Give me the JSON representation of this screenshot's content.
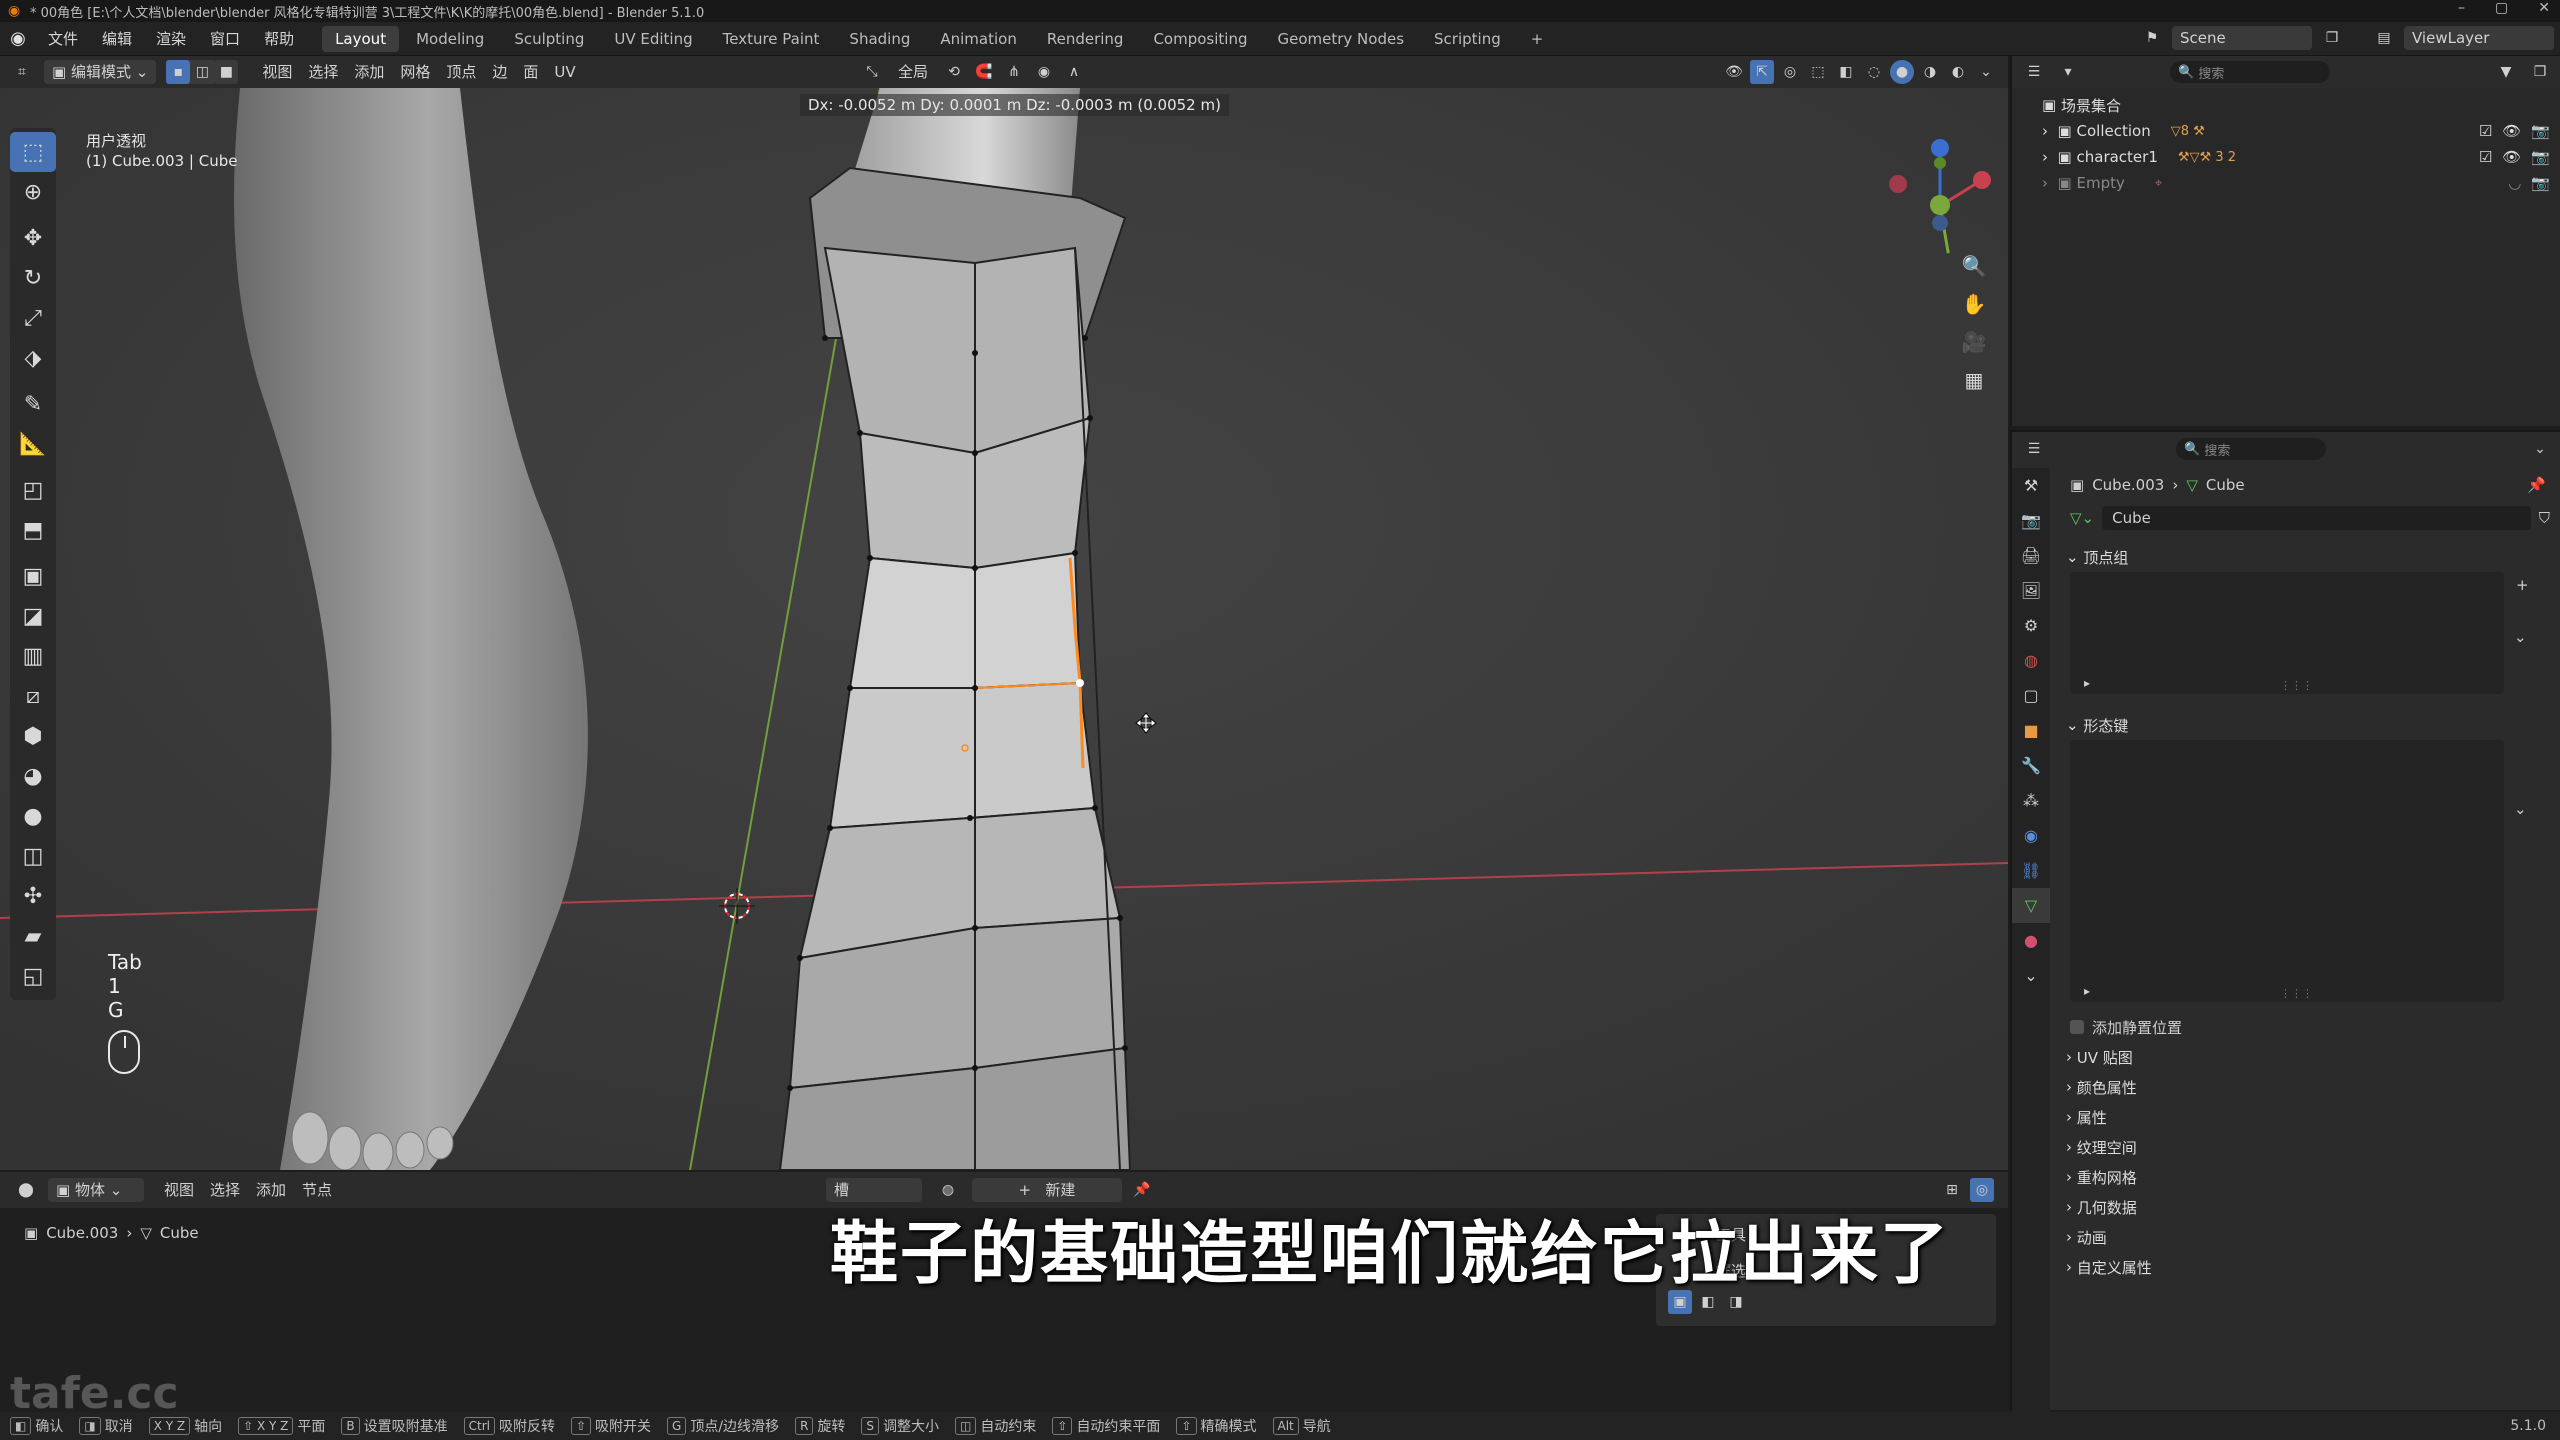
{
  "titlebar": {
    "title": "* 00角色 [E:\\个人文档\\blender\\blender 风格化专辑特训营 3\\工程文件\\K\\K的摩托\\00角色.blend] - Blender 5.1.0",
    "min": "–",
    "max": "▢",
    "close": "✕"
  },
  "menu": {
    "file": "文件",
    "edit": "编辑",
    "render": "渲染",
    "window": "窗口",
    "help": "帮助"
  },
  "workspaces": [
    "Layout",
    "Modeling",
    "Sculpting",
    "UV Editing",
    "Texture Paint",
    "Shading",
    "Animation",
    "Rendering",
    "Compositing",
    "Geometry Nodes",
    "Scripting"
  ],
  "workspace_add": "+",
  "scene": {
    "label": "Scene",
    "viewlayer": "ViewLayer"
  },
  "viewport_header": {
    "mode": "编辑模式",
    "menus": [
      "视图",
      "选择",
      "添加",
      "网格",
      "顶点",
      "边",
      "面",
      "UV"
    ],
    "transform_orientation": "全局"
  },
  "viewport": {
    "view_name": "用户透视",
    "object_info": "(1) Cube.003 | Cube",
    "delta_readout": "Dx: -0.0052 m   Dy:  0.0001 m   Dz: -0.0003 m (0.0052 m)",
    "keys_overlay": [
      "Tab",
      "1",
      "G"
    ]
  },
  "outliner": {
    "search_placeholder": "搜索",
    "root": "场景集合",
    "items": [
      {
        "name": "Collection",
        "badge": "8"
      },
      {
        "name": "character1",
        "badge": "3  2"
      },
      {
        "name": "Empty",
        "badge": ""
      }
    ]
  },
  "properties": {
    "search_placeholder": "搜索",
    "breadcrumb_object": "Cube.003",
    "breadcrumb_data": "Cube",
    "mesh_name": "Cube",
    "panels": {
      "vertex_groups": "顶点组",
      "shape_keys": "形态键",
      "add_rest_position": "添加静置位置",
      "uv_maps": "UV 贴图",
      "color_attributes": "颜色属性",
      "attributes": "属性",
      "texture_space": "纹理空间",
      "remesh": "重构网格",
      "geometry_data": "几何数据",
      "animation": "动画",
      "custom_props": "自定义属性"
    }
  },
  "bottom_editor": {
    "mode": "物体",
    "menus": [
      "视图",
      "选择",
      "添加",
      "节点"
    ],
    "slot": "槽",
    "new_button": "新建",
    "breadcrumb_object": "Cube.003",
    "breadcrumb_data": "Cube",
    "tool_popup": {
      "title": "工具",
      "select": "框选"
    }
  },
  "subtitle": "鞋子的基础造型咱们就给它拉出来了",
  "statusbar": {
    "items": [
      {
        "key": "",
        "label": "确认"
      },
      {
        "key": "",
        "label": "取消"
      },
      {
        "key": "X Y Z",
        "label": "轴向"
      },
      {
        "key": "⇧ X Y Z",
        "label": "平面"
      },
      {
        "key": "B",
        "label": "设置吸附基准"
      },
      {
        "key": "Ctrl",
        "label": "吸附反转"
      },
      {
        "key": "⇧",
        "label": "吸附开关"
      },
      {
        "key": "G",
        "label": "顶点/边线滑移"
      },
      {
        "key": "R",
        "label": "旋转"
      },
      {
        "key": "S",
        "label": "调整大小"
      },
      {
        "key": "",
        "label": "自动约束"
      },
      {
        "key": "⇧",
        "label": "自动约束平面"
      },
      {
        "key": "",
        "label": "精确模式"
      },
      {
        "key": "Alt",
        "label": "导航"
      }
    ],
    "version": "5.1.0"
  },
  "watermark": "tafe.cc",
  "colors": {
    "accent_blue": "#4772b3",
    "selection_orange": "#ff8a1f",
    "axis_red": "#c8414e",
    "axis_green": "#7aa83a",
    "panel_bg": "#2b2b2b"
  }
}
